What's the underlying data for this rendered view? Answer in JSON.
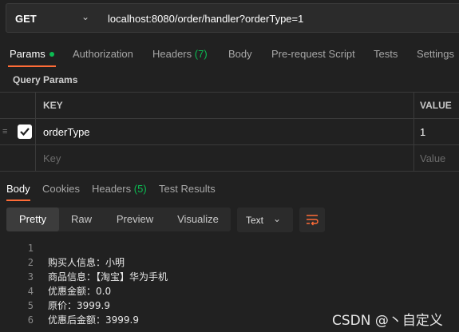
{
  "request": {
    "method": "GET",
    "url": "localhost:8080/order/handler?orderType=1"
  },
  "request_tabs": {
    "params": "Params",
    "authorization": "Authorization",
    "headers": "Headers",
    "headers_count": "(7)",
    "body": "Body",
    "prerequest": "Pre-request Script",
    "tests": "Tests",
    "settings": "Settings"
  },
  "query_params": {
    "title": "Query Params",
    "col_key": "KEY",
    "col_value": "VALUE",
    "rows": [
      {
        "key": "orderType",
        "value": "1",
        "checked": true
      }
    ],
    "placeholder_key": "Key",
    "placeholder_value": "Value"
  },
  "response_tabs": {
    "body": "Body",
    "cookies": "Cookies",
    "headers": "Headers",
    "headers_count": "(5)",
    "test_results": "Test Results"
  },
  "view_modes": {
    "pretty": "Pretty",
    "raw": "Raw",
    "preview": "Preview",
    "visualize": "Visualize",
    "format": "Text"
  },
  "response_body": [
    {
      "n": "1",
      "text": ""
    },
    {
      "n": "2",
      "text": "购买人信息：小明"
    },
    {
      "n": "3",
      "text": "商品信息：【淘宝】华为手机"
    },
    {
      "n": "4",
      "text": "优惠金额：0.0"
    },
    {
      "n": "5",
      "text": "原价：3999.9"
    },
    {
      "n": "6",
      "text": "优惠后金额：3999.9"
    }
  ],
  "watermark": "CSDN @丶自定义",
  "colors": {
    "accent": "#ff6c37",
    "success": "#0cbb52",
    "background": "#212121"
  }
}
